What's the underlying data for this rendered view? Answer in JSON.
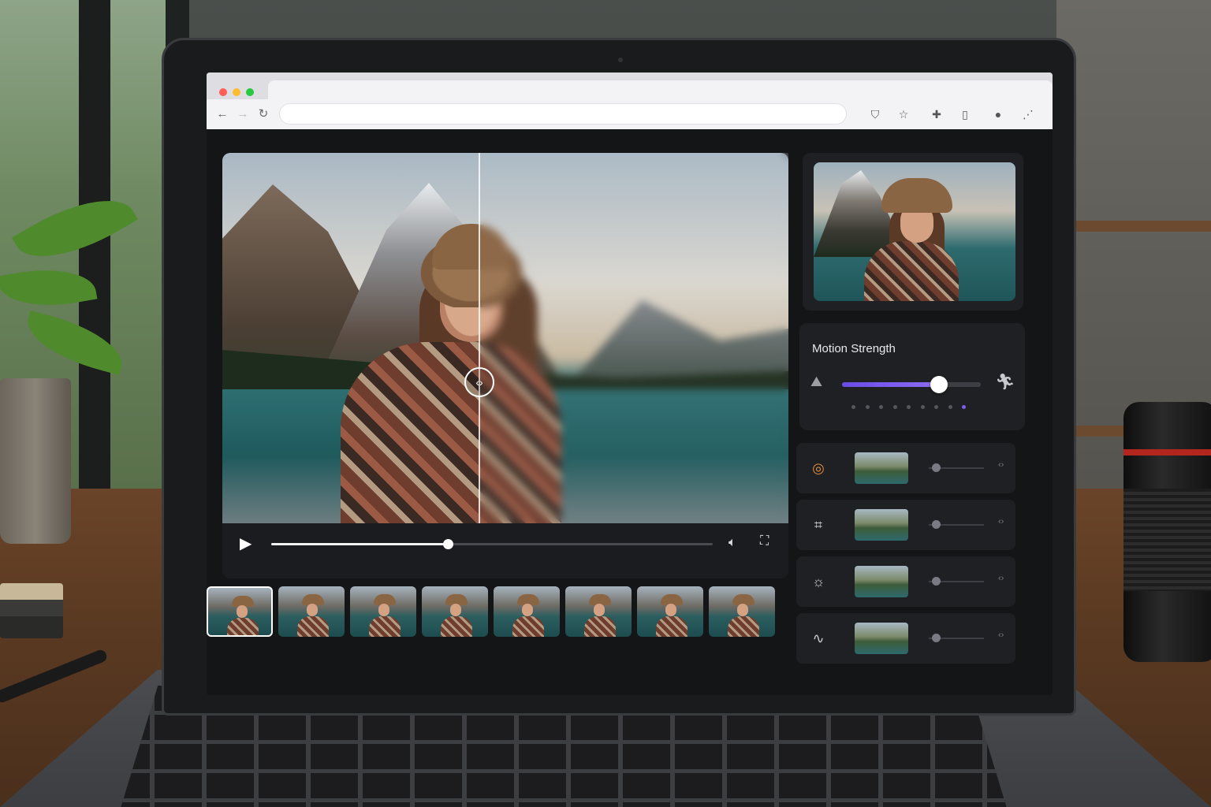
{
  "browser": {
    "traffic_lights": [
      "#ff5f57",
      "#febc2e",
      "#28c840"
    ],
    "nav": {
      "back_icon": "arrow-left-icon",
      "forward_icon": "arrow-right-icon",
      "reload_icon": "reload-icon"
    },
    "toolbar_icons": [
      "shield-icon",
      "star-icon",
      "puzzle-icon",
      "clipboard-icon",
      "profile-icon",
      "menu-dots-icon"
    ]
  },
  "player": {
    "progress_fraction": 0.4,
    "split_handle_glyph": "‹›",
    "play_icon": "play-icon",
    "volume_icon": "volume-icon",
    "fullscreen_icon": "fullscreen-icon"
  },
  "filmstrip": {
    "frame_count": 8,
    "active_index": 0
  },
  "motion_strength": {
    "title": "Motion Strength",
    "value_fraction": 0.7,
    "dot_count": 9,
    "active_dot": 8,
    "low_icon": "mountain-icon",
    "high_icon": "running-icon",
    "accent": "#7c5cf0"
  },
  "adjustments": [
    {
      "icon": "color-wheel-icon",
      "level": 0.05
    },
    {
      "icon": "crop-icon",
      "level": 0.05
    },
    {
      "icon": "brightness-icon",
      "level": 0.05
    },
    {
      "icon": "curve-icon",
      "level": 0.05
    }
  ]
}
